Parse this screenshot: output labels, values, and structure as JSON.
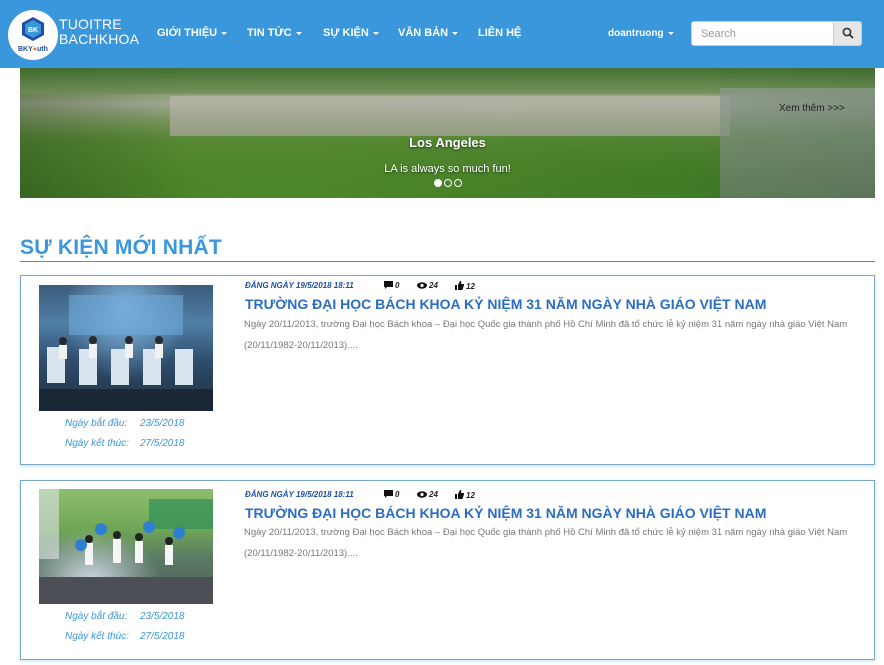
{
  "brand": {
    "line1": "TUOITRE",
    "line2": "BACHKHOA",
    "logo_text_bk": "BK",
    "logo_text_youth_a": "BKY",
    "logo_text_youth_b": "uth"
  },
  "nav": {
    "items": [
      {
        "label": "GIỚI THIỆU",
        "icon": "caret-down-icon"
      },
      {
        "label": "TIN TỨC",
        "icon": "caret-down-icon"
      },
      {
        "label": "SỰ KIỆN",
        "icon": "caret-down-icon"
      },
      {
        "label": "VĂN BẢN",
        "icon": "caret-down-icon"
      },
      {
        "label": "LIÊN HỆ",
        "icon": null
      }
    ],
    "user": "doantruong",
    "search_placeholder": "Search"
  },
  "carousel": {
    "title": "Los Angeles",
    "text": "LA is always so much fun!",
    "more_link": "Xem thêm >>>",
    "slide_count": 3,
    "active_slide": 1
  },
  "section": {
    "title": "SỰ KIỆN MỚI NHẤT"
  },
  "events": [
    {
      "posted": "ĐĂNG NGÀY 19/5/2018 18:11",
      "comments": "0",
      "views": "24",
      "likes": "12",
      "title": "TRƯỜNG ĐẠI HỌC BÁCH KHOA KỶ NIỆM 31 NĂM NGÀY NHÀ GIÁO VIỆT NAM",
      "description": "Ngày 20/11/2013, trường Đại học Bách khoa – Đại học Quốc gia thành phố Hồ Chí Minh đã tổ chức lễ kỷ niệm 31 năm ngày nhà giáo Việt Nam (20/11/1982-20/11/2013)....",
      "start_label": "Ngày bắt đầu:",
      "start_date": "23/5/2018",
      "end_label": "Ngày kết thúc:",
      "end_date": "27/5/2018"
    },
    {
      "posted": "ĐĂNG NGÀY 19/5/2018 18:11",
      "comments": "0",
      "views": "24",
      "likes": "12",
      "title": "TRƯỜNG ĐẠI HỌC BÁCH KHOA KỶ NIỆM 31 NĂM NGÀY NHÀ GIÁO VIỆT NAM",
      "description": "Ngày 20/11/2013, trường Đại học Bách khoa – Đại học Quốc gia thành phố Hồ Chí Minh đã tổ chức lễ kỷ niệm 31 năm ngày nhà giáo Việt Nam (20/11/1982-20/11/2013)....",
      "start_label": "Ngày bắt đầu:",
      "start_date": "23/5/2018",
      "end_label": "Ngày kết thúc:",
      "end_date": "27/5/2018"
    }
  ],
  "colors": {
    "primary": "#3b97dc",
    "title_blue": "#2b6cc4",
    "meta_blue": "#1f4fa0"
  }
}
